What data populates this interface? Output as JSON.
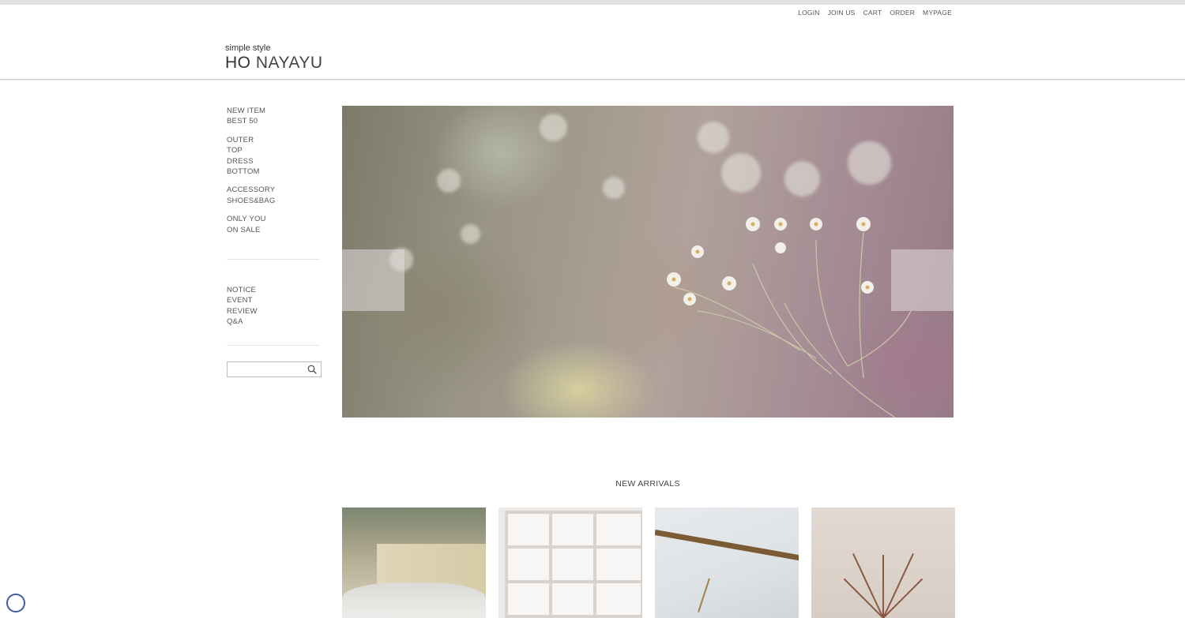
{
  "util_nav": [
    "LOGIN",
    "JOIN US",
    "CART",
    "ORDER",
    "MYPAGE"
  ],
  "logo": {
    "tagline": "simple style",
    "name_bold": "HO",
    "name_rest": "NAYAYU"
  },
  "sidebar": {
    "group1": [
      "NEW ITEM",
      "BEST 50"
    ],
    "group2": [
      "OUTER",
      "TOP",
      "DRESS",
      "BOTTOM"
    ],
    "group3": [
      "ACCESSORY",
      "SHOES&BAG"
    ],
    "group4": [
      "ONLY YOU",
      "ON SALE"
    ],
    "group5": [
      "NOTICE",
      "EVENT",
      "REVIEW",
      "Q&A"
    ],
    "search": {
      "placeholder": "",
      "icon": "search-icon"
    }
  },
  "slider": {
    "prev_icon": "prev-arrow-icon",
    "next_icon": "next-arrow-icon"
  },
  "new_arrivals": {
    "title": "NEW ARRIVALS"
  },
  "colors": {
    "text": "#555555",
    "header_line": "#cfcfcf",
    "chat_icon": "#3f5d9c"
  }
}
